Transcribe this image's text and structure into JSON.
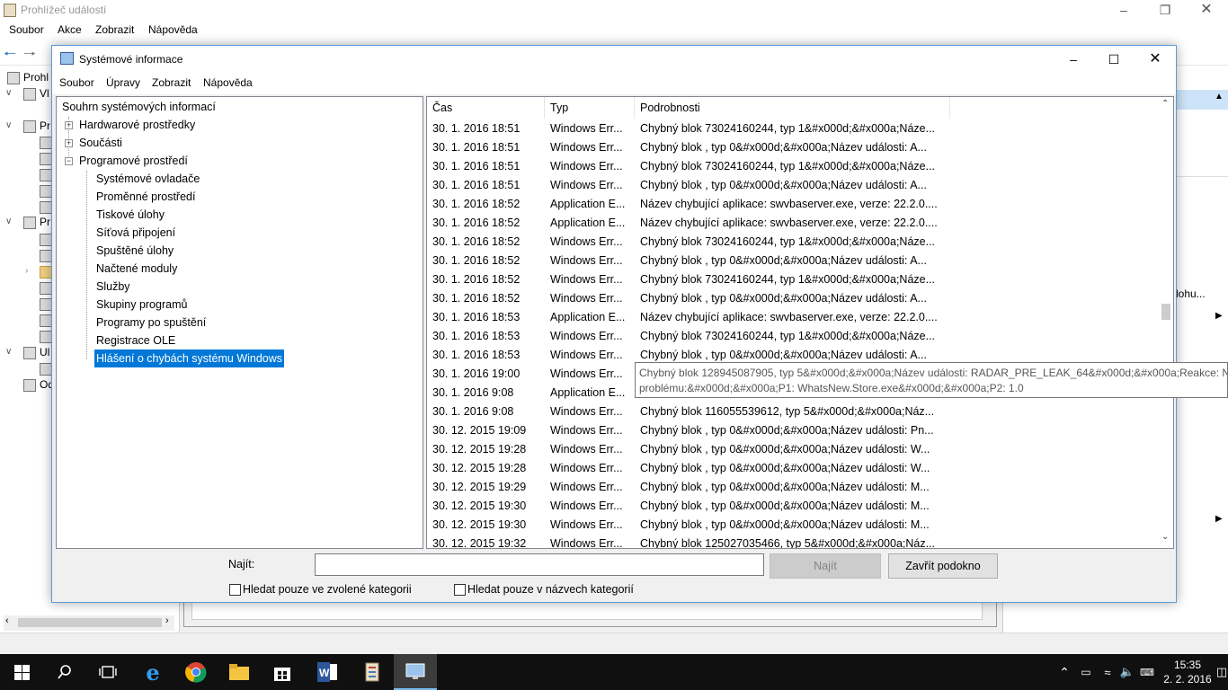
{
  "event_viewer": {
    "title": "Prohlížeč událostí",
    "menu": [
      "Soubor",
      "Akce",
      "Zobrazit",
      "Nápověda"
    ],
    "left_tree_partial": [
      "Prohl",
      "Vl",
      "Pr",
      "Pr",
      "Ul",
      "Od"
    ],
    "right_partial": "lohu..."
  },
  "sysinfo": {
    "title": "Systémové informace",
    "menu": [
      "Soubor",
      "Úpravy",
      "Zobrazit",
      "Nápověda"
    ],
    "tree": {
      "root": "Souhrn systémových informací",
      "items": [
        {
          "label": "Hardwarové prostředky",
          "expander": "+"
        },
        {
          "label": "Součásti",
          "expander": "+"
        },
        {
          "label": "Programové prostředí",
          "expander": "−"
        }
      ],
      "children": [
        "Systémové ovladače",
        "Proměnné prostředí",
        "Tiskové úlohy",
        "Síťová připojení",
        "Spuštěné úlohy",
        "Načtené moduly",
        "Služby",
        "Skupiny programů",
        "Programy po spuštění",
        "Registrace OLE",
        "Hlášení o chybách systému Windows"
      ]
    },
    "list": {
      "columns": [
        "Čas",
        "Typ",
        "Podrobnosti"
      ],
      "rows": [
        [
          "30. 1. 2016 18:51",
          "Windows Err...",
          "Chybný blok 73024160244, typ 1&#x000d;&#x000a;Náze..."
        ],
        [
          "30. 1. 2016 18:51",
          "Windows Err...",
          "Chybný blok , typ 0&#x000d;&#x000a;Název události: A..."
        ],
        [
          "30. 1. 2016 18:51",
          "Windows Err...",
          "Chybný blok 73024160244, typ 1&#x000d;&#x000a;Náze..."
        ],
        [
          "30. 1. 2016 18:51",
          "Windows Err...",
          "Chybný blok , typ 0&#x000d;&#x000a;Název události: A..."
        ],
        [
          "30. 1. 2016 18:52",
          "Application E...",
          "Název chybující aplikace: swvbaserver.exe, verze: 22.2.0...."
        ],
        [
          "30. 1. 2016 18:52",
          "Application E...",
          "Název chybující aplikace: swvbaserver.exe, verze: 22.2.0...."
        ],
        [
          "30. 1. 2016 18:52",
          "Windows Err...",
          "Chybný blok 73024160244, typ 1&#x000d;&#x000a;Náze..."
        ],
        [
          "30. 1. 2016 18:52",
          "Windows Err...",
          "Chybný blok , typ 0&#x000d;&#x000a;Název události: A..."
        ],
        [
          "30. 1. 2016 18:52",
          "Windows Err...",
          "Chybný blok 73024160244, typ 1&#x000d;&#x000a;Náze..."
        ],
        [
          "30. 1. 2016 18:52",
          "Windows Err...",
          "Chybný blok , typ 0&#x000d;&#x000a;Název události: A..."
        ],
        [
          "30. 1. 2016 18:53",
          "Application E...",
          "Název chybující aplikace: swvbaserver.exe, verze: 22.2.0...."
        ],
        [
          "30. 1. 2016 18:53",
          "Windows Err...",
          "Chybný blok 73024160244, typ 1&#x000d;&#x000a;Náze..."
        ],
        [
          "30. 1. 2016 18:53",
          "Windows Err...",
          "Chybný blok , typ 0&#x000d;&#x000a;Název události: A..."
        ],
        [
          "30. 1. 2016 19:00",
          "Windows Err...",
          ""
        ],
        [
          "30. 1. 2016 9:08",
          "Application E...",
          ""
        ],
        [
          "30. 1. 2016 9:08",
          "Windows Err...",
          "Chybný blok 116055539612, typ 5&#x000d;&#x000a;Náz..."
        ],
        [
          "30. 12. 2015 19:09",
          "Windows Err...",
          "Chybný blok , typ 0&#x000d;&#x000a;Název události: Pn..."
        ],
        [
          "30. 12. 2015 19:28",
          "Windows Err...",
          "Chybný blok , typ 0&#x000d;&#x000a;Název události: W..."
        ],
        [
          "30. 12. 2015 19:28",
          "Windows Err...",
          "Chybný blok , typ 0&#x000d;&#x000a;Název události: W..."
        ],
        [
          "30. 12. 2015 19:29",
          "Windows Err...",
          "Chybný blok , typ 0&#x000d;&#x000a;Název události: M..."
        ],
        [
          "30. 12. 2015 19:30",
          "Windows Err...",
          "Chybný blok , typ 0&#x000d;&#x000a;Název události: M..."
        ],
        [
          "30. 12. 2015 19:30",
          "Windows Err...",
          "Chybný blok , typ 0&#x000d;&#x000a;Název události: M..."
        ],
        [
          "30. 12. 2015 19:32",
          "Windows Err...",
          "Chybný blok 125027035466, typ 5&#x000d;&#x000a;Náz..."
        ]
      ]
    },
    "tooltip": {
      "line1": "Chybný blok 128945087905, typ 5&#x000d;&#x000a;Název události: RADAR_PRE_LEAK_64&#x000d;&#x000a;Reakce: Není k dispozici",
      "line2": "problému:&#x000d;&#x000a;P1: WhatsNew.Store.exe&#x000d;&#x000a;P2: 1.0"
    },
    "find": {
      "label": "Najít:",
      "value": "",
      "find_button": "Najít",
      "close_button": "Zavřít podokno",
      "check1": "Hledat pouze ve zvolené kategorii",
      "check2": "Hledat pouze v názvech kategorií"
    }
  },
  "taskbar": {
    "time": "15:35",
    "date": "2. 2. 2016"
  },
  "colors": {
    "selection": "#0078d7",
    "taskbar": "#101010",
    "window_border": "#5b9bd5"
  }
}
